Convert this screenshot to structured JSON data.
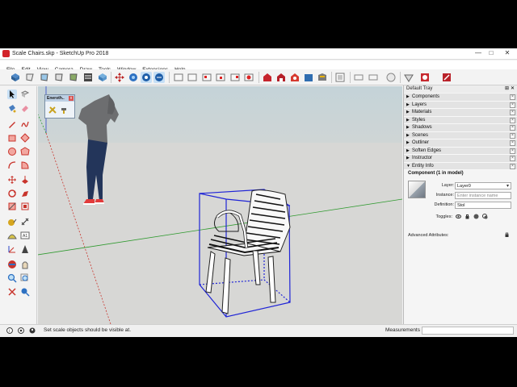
{
  "window": {
    "title": "Scale Chairs.skp - SketchUp Pro 2018",
    "controls": [
      "—",
      "□",
      "✕"
    ]
  },
  "menu": [
    "File",
    "Edit",
    "View",
    "Camera",
    "Draw",
    "Tools",
    "Window",
    "Extensions",
    "Help"
  ],
  "floating_window": {
    "title": "Eneroth..",
    "close": "x"
  },
  "tray": {
    "title": "Default Tray",
    "close": "✕",
    "sections": [
      {
        "label": "Components",
        "expanded": false
      },
      {
        "label": "Layers",
        "expanded": false
      },
      {
        "label": "Materials",
        "expanded": false
      },
      {
        "label": "Styles",
        "expanded": false
      },
      {
        "label": "Shadows",
        "expanded": false
      },
      {
        "label": "Scenes",
        "expanded": false
      },
      {
        "label": "Outliner",
        "expanded": false
      },
      {
        "label": "Soften Edges",
        "expanded": false
      },
      {
        "label": "Instructor",
        "expanded": false
      },
      {
        "label": "Entity Info",
        "expanded": true
      }
    ],
    "entity_info": {
      "header": "Component (1 in model)",
      "layer_label": "Layer:",
      "layer_value": "Layer0",
      "instance_label": "Instance:",
      "instance_placeholder": "Enter instance name",
      "definition_label": "Definition:",
      "definition_value": "Stol",
      "toggles_label": "Toggles:",
      "advanced_label": "Advanced Attributes:"
    }
  },
  "status": {
    "message": "Set scale objects should be visible at.",
    "measurements_label": "Measurements",
    "measurements_value": ""
  },
  "colors": {
    "axis_red": "#c8342c",
    "axis_green": "#2f9a2f",
    "axis_blue": "#2e45c7",
    "bbox": "#1f24d6"
  }
}
